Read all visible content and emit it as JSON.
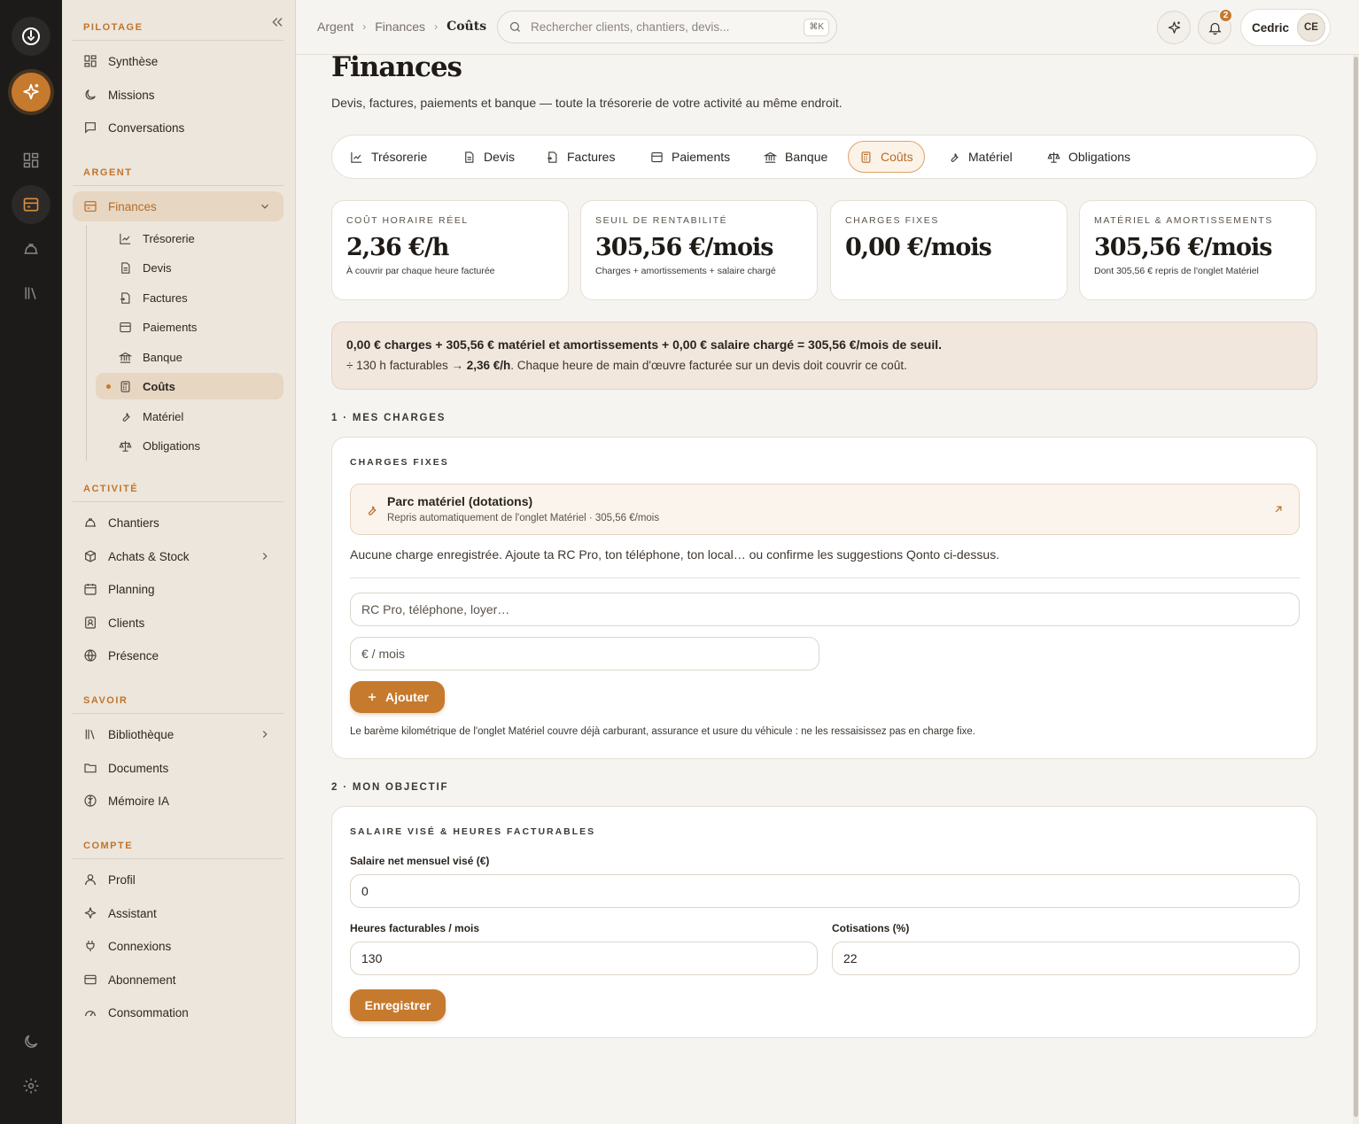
{
  "sidebar": {
    "sections": {
      "pilotage": "PILOTAGE",
      "argent": "ARGENT",
      "activite": "ACTIVITÉ",
      "savoir": "SAVOIR",
      "compte": "COMPTE"
    },
    "pilotage_items": [
      "Synthèse",
      "Missions",
      "Conversations"
    ],
    "finances_label": "Finances",
    "finances_sub": [
      "Trésorerie",
      "Devis",
      "Factures",
      "Paiements",
      "Banque",
      "Coûts",
      "Matériel",
      "Obligations"
    ],
    "activite_items": [
      "Chantiers",
      "Achats & Stock",
      "Planning",
      "Clients",
      "Présence"
    ],
    "savoir_items": [
      "Bibliothèque",
      "Documents",
      "Mémoire IA"
    ],
    "compte_items": [
      "Profil",
      "Assistant",
      "Connexions",
      "Abonnement",
      "Consommation"
    ]
  },
  "topbar": {
    "breadcrumb": [
      "Argent",
      "Finances",
      "Coûts"
    ],
    "search_placeholder": "Rechercher clients, chantiers, devis...",
    "search_shortcut": "⌘K",
    "notifications_count": "2",
    "user_name": "Cedric",
    "user_initials": "CE"
  },
  "page": {
    "title": "Finances",
    "subtitle": "Devis, factures, paiements et banque — toute la trésorerie de votre activité au même endroit.",
    "tabs": [
      "Trésorerie",
      "Devis",
      "Factures",
      "Paiements",
      "Banque",
      "Coûts",
      "Matériel",
      "Obligations"
    ],
    "active_tab": "Coûts"
  },
  "kpis": [
    {
      "label": "COÛT HORAIRE RÉEL",
      "value": "2,36 €/h",
      "caption": "À couvrir par chaque heure facturée"
    },
    {
      "label": "SEUIL DE RENTABILITÉ",
      "value": "305,56 €/mois",
      "caption": "Charges + amortissements + salaire chargé"
    },
    {
      "label": "CHARGES FIXES",
      "value": "0,00 €/mois",
      "caption": ""
    },
    {
      "label": "MATÉRIEL & AMORTISSEMENTS",
      "value": "305,56 €/mois",
      "caption": "Dont 305,56 € repris de l'onglet Matériel"
    }
  ],
  "banner": {
    "line1": "0,00 € charges + 305,56 € matériel et amortissements + 0,00 € salaire chargé = 305,56 €/mois de seuil.",
    "line2_prefix": "÷ 130 h facturables → ",
    "line2_bold": "2,36 €/h",
    "line2_suffix": ". Chaque heure de main d'œuvre facturée sur un devis doit couvrir ce coût."
  },
  "charges": {
    "section_title": "1 · MES CHARGES",
    "card_title": "CHARGES FIXES",
    "parc_title": "Parc matériel (dotations)",
    "parc_subtitle": "Repris automatiquement de l'onglet Matériel · 305,56 €/mois",
    "empty_text": "Aucune charge enregistrée. Ajoute ta RC Pro, ton téléphone, ton local… ou confirme les suggestions Qonto ci-dessus.",
    "name_placeholder": "RC Pro, téléphone, loyer…",
    "amount_placeholder": "€ / mois",
    "add_label": "Ajouter",
    "note": "Le barème kilométrique de l'onglet Matériel couvre déjà carburant, assurance et usure du véhicule : ne les ressaisissez pas en charge fixe."
  },
  "objectif": {
    "section_title": "2 · MON OBJECTIF",
    "card_title": "SALAIRE VISÉ & HEURES FACTURABLES",
    "salary_label": "Salaire net mensuel visé (€)",
    "salary_value": "0",
    "hours_label": "Heures facturables / mois",
    "hours_value": "130",
    "cotisations_label": "Cotisations (%)",
    "cotisations_value": "22",
    "save_label": "Enregistrer"
  },
  "colors": {
    "accent": "#c67a2e",
    "rail": "#1c1b1a",
    "sidebar": "#ede6dc",
    "banner": "#f1e7dd"
  }
}
